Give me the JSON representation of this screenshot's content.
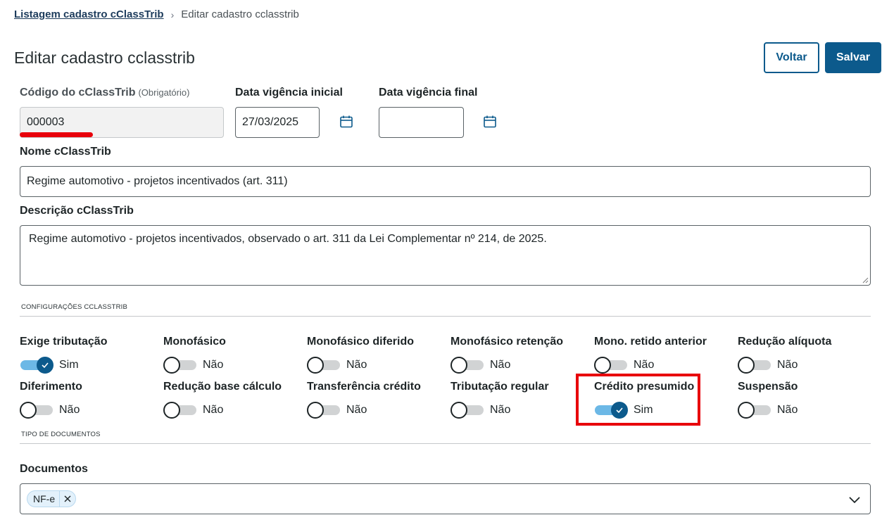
{
  "breadcrumb": {
    "parent": "Listagem cadastro cClassTrib",
    "separator": "›",
    "current": "Editar cadastro cclasstrib"
  },
  "header": {
    "title": "Editar cadastro cclasstrib",
    "back_label": "Voltar",
    "save_label": "Salvar"
  },
  "fields": {
    "codigo": {
      "label": "Código do cClassTrib",
      "hint": "(Obrigatório)",
      "value": "000003"
    },
    "data_inicial": {
      "label": "Data vigência inicial",
      "value": "27/03/2025"
    },
    "data_final": {
      "label": "Data vigência final",
      "value": ""
    },
    "nome": {
      "label": "Nome cClassTrib",
      "value": "Regime automotivo - projetos incentivados (art. 311)"
    },
    "descricao": {
      "label": "Descrição cClassTrib",
      "value": "Regime automotivo - projetos incentivados, observado o art. 311 da Lei Complementar nº 214, de 2025."
    }
  },
  "config_section": {
    "title": "CONFIGURAÇÕES CCLASSTRIB",
    "switches": [
      {
        "label": "Exige tributação",
        "on": true,
        "state_text": "Sim"
      },
      {
        "label": "Monofásico",
        "on": false,
        "state_text": "Não"
      },
      {
        "label": "Monofásico diferido",
        "on": false,
        "state_text": "Não"
      },
      {
        "label": "Monofásico retenção",
        "on": false,
        "state_text": "Não"
      },
      {
        "label": "Mono. retido anterior",
        "on": false,
        "state_text": "Não"
      },
      {
        "label": "Redução alíquota",
        "on": false,
        "state_text": "Não"
      },
      {
        "label": "Diferimento",
        "on": false,
        "state_text": "Não"
      },
      {
        "label": "Redução base cálculo",
        "on": false,
        "state_text": "Não"
      },
      {
        "label": "Transferência crédito",
        "on": false,
        "state_text": "Não"
      },
      {
        "label": "Tributação regular",
        "on": false,
        "state_text": "Não"
      },
      {
        "label": "Crédito presumido",
        "on": true,
        "state_text": "Sim"
      },
      {
        "label": "Suspensão",
        "on": false,
        "state_text": "Não"
      }
    ]
  },
  "docs_section": {
    "title": "TIPO DE DOCUMENTOS",
    "label": "Documentos",
    "selected": [
      "NF-e"
    ]
  },
  "colors": {
    "primary": "#0c5a8c",
    "switch_on_track": "#6cb8e6",
    "annotation_red": "#e8000b"
  }
}
